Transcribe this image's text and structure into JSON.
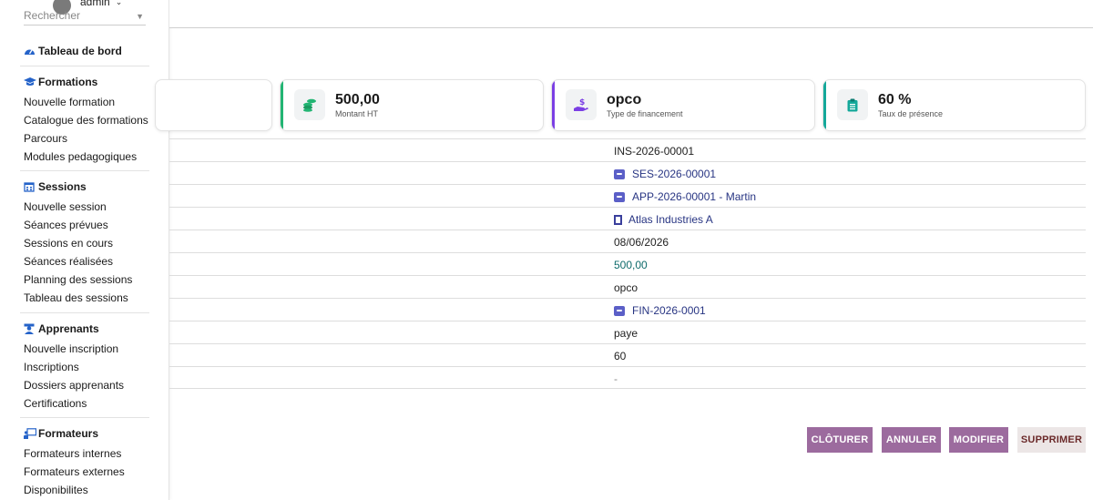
{
  "user": {
    "name": "admin"
  },
  "search": {
    "placeholder": "Rechercher"
  },
  "sidebar": {
    "dashboard": "Tableau de bord",
    "sections": [
      {
        "title": "Formations",
        "items": [
          "Nouvelle formation",
          "Catalogue des formations",
          "Parcours",
          "Modules pedagogiques"
        ]
      },
      {
        "title": "Sessions",
        "items": [
          "Nouvelle session",
          "Séances prévues",
          "Sessions en cours",
          "Séances réalisées",
          "Planning des sessions",
          "Tableau des sessions"
        ]
      },
      {
        "title": "Apprenants",
        "items": [
          "Nouvelle inscription",
          "Inscriptions",
          "Dossiers apprenants",
          "Certifications"
        ]
      },
      {
        "title": "Formateurs",
        "items": [
          "Formateurs internes",
          "Formateurs externes",
          "Disponibilites"
        ]
      }
    ]
  },
  "cards": [
    {
      "value": "500,00",
      "label": "Montant HT",
      "icon": "coins-icon",
      "accent": "#22b573"
    },
    {
      "value": "opco",
      "label": "Type de financement",
      "icon": "hand-money-icon",
      "accent": "#7b3fe4"
    },
    {
      "value": "60 %",
      "label": "Taux de présence",
      "icon": "clipboard-icon",
      "accent": "#14a89a"
    }
  ],
  "details": [
    {
      "value": "INS-2026-00001",
      "style": "plain",
      "icon": ""
    },
    {
      "value": "SES-2026-00001",
      "style": "link",
      "icon": "record-icon"
    },
    {
      "value": "APP-2026-00001 - Martin",
      "style": "link",
      "icon": "record-icon"
    },
    {
      "value": "Atlas Industries A",
      "style": "link",
      "icon": "building-icon"
    },
    {
      "value": "08/06/2026",
      "style": "plain",
      "icon": ""
    },
    {
      "value": "500,00",
      "style": "teal",
      "icon": ""
    },
    {
      "value": "opco",
      "style": "plain",
      "icon": ""
    },
    {
      "value": "FIN-2026-0001",
      "style": "link",
      "icon": "record-icon"
    },
    {
      "value": "paye",
      "style": "plain",
      "icon": ""
    },
    {
      "value": "60",
      "style": "plain",
      "icon": ""
    },
    {
      "value": "-",
      "style": "muted",
      "icon": ""
    }
  ],
  "actions": {
    "close_label": "CLÔTURER",
    "cancel_label": "ANNULER",
    "edit_label": "MODIFIER",
    "delete_label": "SUPPRIMER"
  },
  "colors": {
    "button_primary": "#9c6b9e",
    "button_light": "#ece6e6",
    "button_light_text": "#6b2a2a",
    "link": "#283583"
  }
}
